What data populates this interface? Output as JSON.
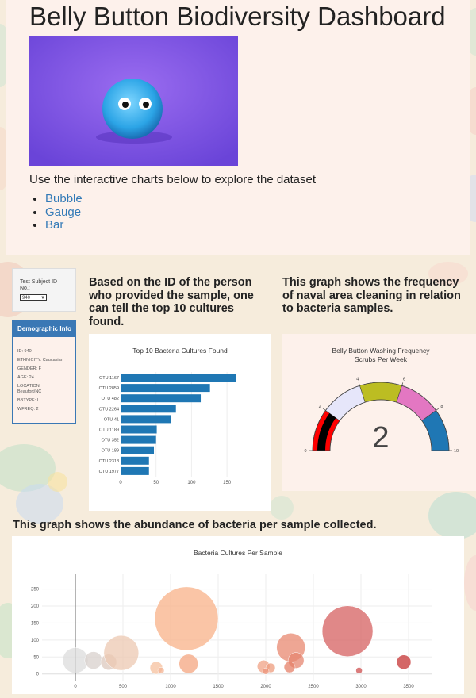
{
  "header": {
    "title": "Belly Button Biodiversity Dashboard",
    "lead": "Use the interactive charts below to explore the dataset",
    "links": [
      "Bubble",
      "Gauge",
      "Bar"
    ]
  },
  "selector": {
    "label": "Test Subject ID No.:",
    "value": "940"
  },
  "demographics": {
    "title": "Demographic Info",
    "rows": [
      "ID: 940",
      "ETHNICITY: Caucasian",
      "GENDER: F",
      "AGE: 24",
      "LOCATION: Beaufort/NC",
      "BBTYPE: I",
      "WFREQ: 2"
    ]
  },
  "captions": {
    "bar": "Based on the ID of the person who provided the sample, one can tell the top 10 cultures found.",
    "gauge": "This graph shows the frequency of naval area cleaning in relation to bacteria samples.",
    "bubble": "This graph shows the abundance of bacteria per sample collected."
  },
  "colors": {
    "bar": "#1f77b4",
    "demo_header": "#3a78b5",
    "link": "#337ab7"
  },
  "chart_data": [
    {
      "type": "bar",
      "orientation": "horizontal",
      "title": "Top 10 Bacteria Cultures Found",
      "categories": [
        "OTU 1167",
        "OTU 2859",
        "OTU 482",
        "OTU 2264",
        "OTU 41",
        "OTU 1189",
        "OTU 352",
        "OTU 189",
        "OTU 2318",
        "OTU 1977"
      ],
      "values": [
        163,
        126,
        113,
        78,
        71,
        51,
        50,
        47,
        40,
        40
      ],
      "xlim": [
        0,
        170
      ],
      "xticks": [
        0,
        50,
        100,
        150
      ]
    },
    {
      "type": "gauge",
      "title": "Belly Button Washing Frequency",
      "subtitle": "Scrubs Per Week",
      "value": 2,
      "range": [
        0,
        10
      ],
      "ticks": [
        0,
        2,
        4,
        6,
        8,
        10
      ],
      "steps": [
        {
          "range": [
            0,
            2
          ],
          "color": "#ff0000"
        },
        {
          "range": [
            2,
            4
          ],
          "color": "#e6e6fa"
        },
        {
          "range": [
            4,
            6
          ],
          "color": "#bcbd22"
        },
        {
          "range": [
            6,
            8
          ],
          "color": "#e377c2"
        },
        {
          "range": [
            8,
            10
          ],
          "color": "#1f77b4"
        }
      ],
      "bar_color": "#000000"
    },
    {
      "type": "scatter",
      "title": "Bacteria Cultures Per Sample",
      "xlim": [
        -350,
        3750
      ],
      "ylim": [
        -10,
        270
      ],
      "xticks": [
        0,
        500,
        1000,
        1500,
        2000,
        2500,
        3000,
        3500
      ],
      "yticks": [
        0,
        50,
        100,
        150,
        200,
        250
      ],
      "points": [
        {
          "x": 0,
          "y": 40,
          "r": 16,
          "color": "#dcdcdc"
        },
        {
          "x": 190,
          "y": 40,
          "r": 11,
          "color": "#d8d0cc"
        },
        {
          "x": 350,
          "y": 35,
          "r": 10,
          "color": "#dcc8be"
        },
        {
          "x": 482,
          "y": 62,
          "r": 22,
          "color": "#ecc8b2"
        },
        {
          "x": 850,
          "y": 18,
          "r": 8,
          "color": "#f6c09e"
        },
        {
          "x": 1167,
          "y": 163,
          "r": 40,
          "color": "#f8b188"
        },
        {
          "x": 1189,
          "y": 30,
          "r": 12,
          "color": "#f4a680"
        },
        {
          "x": 1977,
          "y": 22,
          "r": 8,
          "color": "#f0a284"
        },
        {
          "x": 2050,
          "y": 18,
          "r": 6,
          "color": "#ee9c7e"
        },
        {
          "x": 2264,
          "y": 78,
          "r": 18,
          "color": "#e88870"
        },
        {
          "x": 2318,
          "y": 40,
          "r": 10,
          "color": "#e68670"
        },
        {
          "x": 2250,
          "y": 20,
          "r": 7,
          "color": "#e58068"
        },
        {
          "x": 2859,
          "y": 126,
          "r": 32,
          "color": "#d66060"
        },
        {
          "x": 3450,
          "y": 35,
          "r": 9,
          "color": "#c63434"
        },
        {
          "x": 2980,
          "y": 10,
          "r": 4,
          "color": "#cf5050"
        },
        {
          "x": 900,
          "y": 10,
          "r": 4,
          "color": "#f4b494"
        },
        {
          "x": 2000,
          "y": 8,
          "r": 4,
          "color": "#ec947a"
        }
      ]
    }
  ]
}
